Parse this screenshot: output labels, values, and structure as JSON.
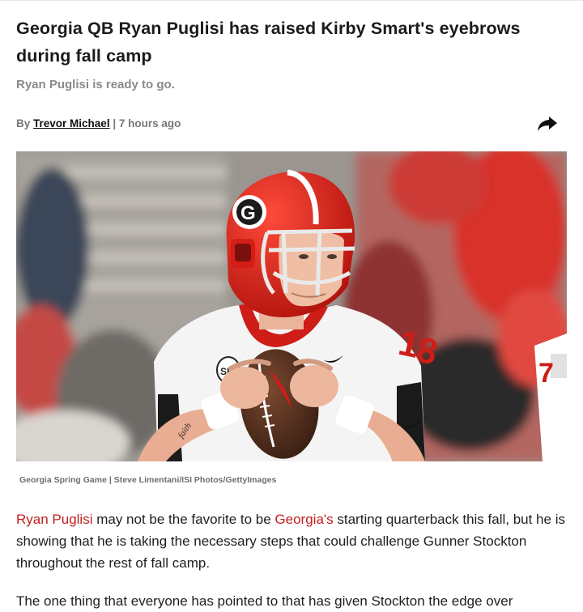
{
  "article": {
    "title": "Georgia QB Ryan Puglisi has raised Kirby Smart's eyebrows during fall camp",
    "subtitle": "Ryan Puglisi is ready to go.",
    "byline": {
      "prefix": "By",
      "author": "Trevor Michael",
      "separator": "|",
      "time": "7 hours ago"
    },
    "share_icon": "share-arrow-icon",
    "image": {
      "alt": "Georgia quarterback in red helmet holding a football",
      "caption": "Georgia Spring Game | Steve Limentani/ISI Photos/GettyImages"
    },
    "paragraph1": {
      "link1": "Ryan Puglisi",
      "text1": " may not be the favorite to be ",
      "link2": "Georgia's",
      "text2": " starting quarterback this fall, but he is showing that he is taking the necessary steps that could challenge Gunner Stockton throughout the rest of fall camp."
    },
    "paragraph2": "The one thing that everyone has pointed to that has given Stockton the edge over"
  },
  "colors": {
    "link": "#c0211f",
    "title": "#1b1b1b",
    "muted": "#8a8a8a"
  }
}
